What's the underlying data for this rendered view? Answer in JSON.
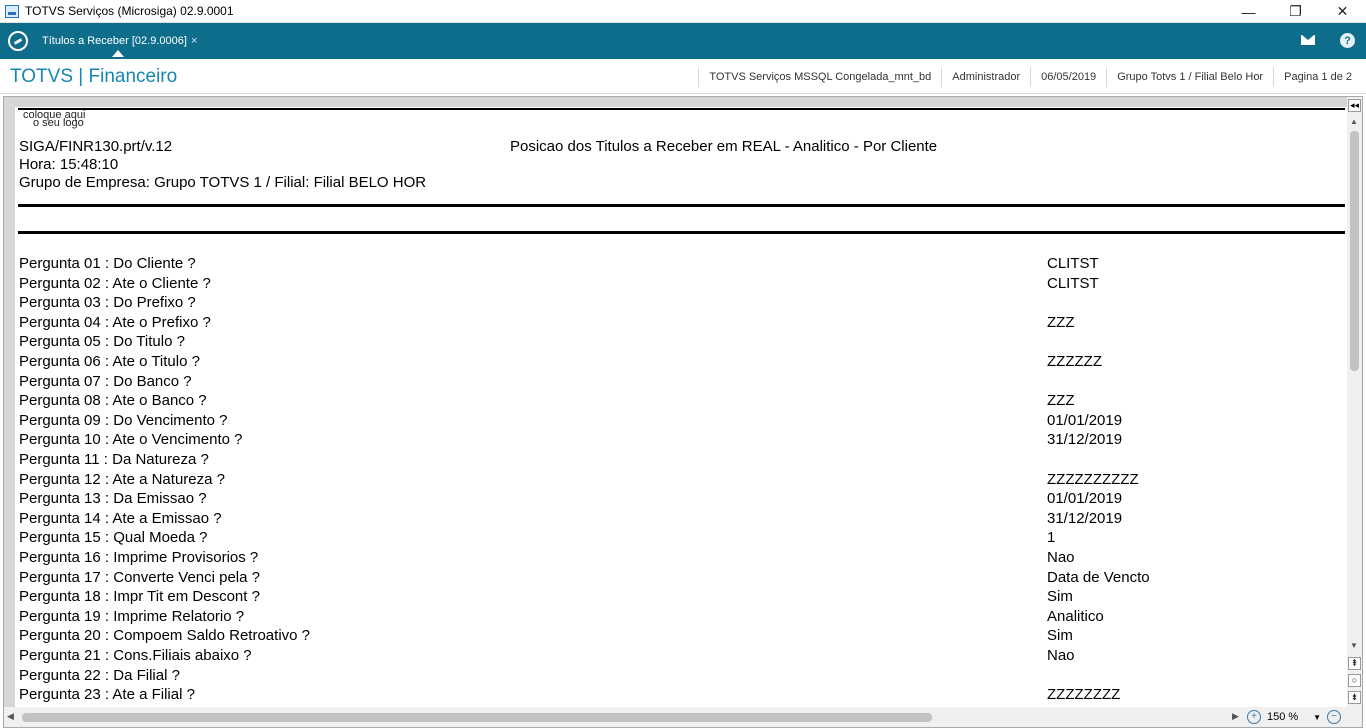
{
  "window": {
    "title": "TOTVS Serviços (Microsiga) 02.9.0001",
    "minimize": "—",
    "restore": "❐",
    "close": "✕"
  },
  "tabbar": {
    "tab_label": "Títulos a Receber [02.9.0006]",
    "tab_close": "×",
    "help": "?"
  },
  "header": {
    "module": "TOTVS | Financeiro",
    "info": [
      "TOTVS Serviços MSSQL Congelada_mnt_bd",
      "Administrador",
      "06/05/2019",
      "Grupo Totvs 1 / Filial Belo Hor",
      "Pagina 1 de 2"
    ]
  },
  "report": {
    "logo_line1": "coloque aqui",
    "logo_line2": "o seu logo",
    "program": "SIGA/FINR130.prt/v.12",
    "title": "Posicao dos Titulos a Receber em REAL - Analitico - Por Cliente",
    "time": "Hora: 15:48:10",
    "group": "Grupo de Empresa: Grupo TOTVS 1 / Filial: Filial BELO HOR",
    "questions": [
      {
        "label": "Pergunta 01 : Do Cliente ?",
        "value": "CLITST"
      },
      {
        "label": "Pergunta 02 : Ate o Cliente ?",
        "value": "CLITST"
      },
      {
        "label": "Pergunta 03 : Do Prefixo ?",
        "value": ""
      },
      {
        "label": "Pergunta 04 : Ate o Prefixo ?",
        "value": "ZZZ"
      },
      {
        "label": "Pergunta 05 : Do Titulo ?",
        "value": ""
      },
      {
        "label": "Pergunta 06 : Ate o Titulo ?",
        "value": "ZZZZZZ"
      },
      {
        "label": "Pergunta 07 : Do Banco ?",
        "value": ""
      },
      {
        "label": "Pergunta 08 : Ate o Banco ?",
        "value": "ZZZ"
      },
      {
        "label": "Pergunta 09 : Do Vencimento ?",
        "value": "01/01/2019"
      },
      {
        "label": "Pergunta 10 : Ate o Vencimento ?",
        "value": "31/12/2019"
      },
      {
        "label": "Pergunta 11 : Da Natureza ?",
        "value": ""
      },
      {
        "label": "Pergunta 12 : Ate a Natureza ?",
        "value": "ZZZZZZZZZZ"
      },
      {
        "label": "Pergunta 13 : Da Emissao ?",
        "value": "01/01/2019"
      },
      {
        "label": "Pergunta 14 : Ate a Emissao ?",
        "value": "31/12/2019"
      },
      {
        "label": "Pergunta 15 : Qual Moeda ?",
        "value": "1"
      },
      {
        "label": "Pergunta 16 : Imprime Provisorios ?",
        "value": "Nao"
      },
      {
        "label": "Pergunta 17 : Converte Venci pela ?",
        "value": "Data de Vencto"
      },
      {
        "label": "Pergunta 18 : Impr Tit em Descont ?",
        "value": "Sim"
      },
      {
        "label": "Pergunta 19 : Imprime Relatorio ?",
        "value": "Analitico"
      },
      {
        "label": "Pergunta 20 : Compoem Saldo Retroativo ?",
        "value": "Sim"
      },
      {
        "label": "Pergunta 21 : Cons.Filiais abaixo ?",
        "value": "Nao"
      },
      {
        "label": "Pergunta 22 : Da Filial ?",
        "value": ""
      },
      {
        "label": "Pergunta 23 : Ate a Filial ?",
        "value": "ZZZZZZZZ"
      }
    ]
  },
  "viewer": {
    "zoom": "150 %",
    "collapse": "◂◂",
    "page_up": "⇞",
    "page_circle": "○",
    "page_down": "⇟",
    "zoom_in": "+",
    "zoom_out": "−",
    "scroll_up": "▲",
    "scroll_down": "▼",
    "scroll_left": "◀",
    "scroll_right": "▶",
    "dropdown": "▼"
  },
  "colors": {
    "tabbar": "#0f6d8c",
    "module_title": "#1687b0"
  }
}
